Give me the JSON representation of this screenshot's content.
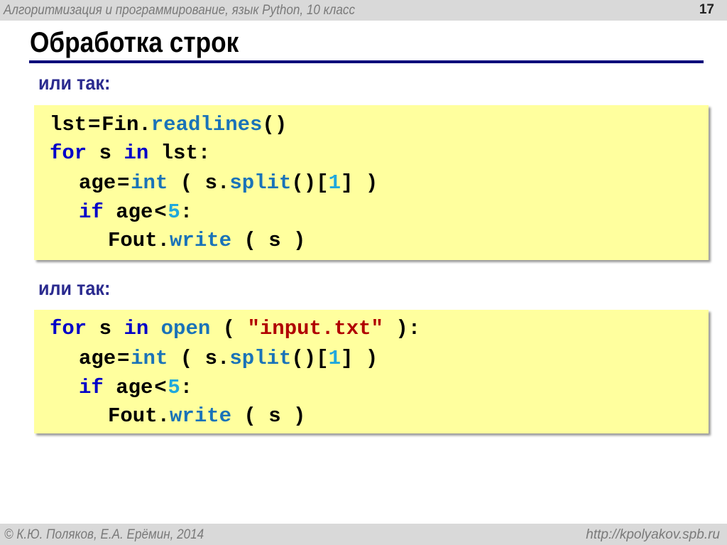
{
  "header": {
    "course": "Алгоритмизация и программирование, язык Python, 10 класс",
    "page_number": "17"
  },
  "title": "Обработка строк",
  "sections": [
    {
      "label": "или так:",
      "code": [
        {
          "indent": 0,
          "tokens": [
            [
              "t",
              "lst"
            ],
            [
              "o",
              "="
            ],
            [
              "t",
              "Fin."
            ],
            [
              "f",
              "readlines"
            ],
            [
              "t",
              "()"
            ]
          ]
        },
        {
          "indent": 0,
          "tokens": [
            [
              "k",
              "for"
            ],
            [
              "t",
              " s "
            ],
            [
              "k",
              "in"
            ],
            [
              "t",
              " lst:"
            ]
          ]
        },
        {
          "indent": 1,
          "tokens": [
            [
              "t",
              "age"
            ],
            [
              "o",
              "="
            ],
            [
              "f",
              "int"
            ],
            [
              "t",
              " ( s."
            ],
            [
              "f",
              "split"
            ],
            [
              "t",
              "()["
            ],
            [
              "n",
              "1"
            ],
            [
              "t",
              "] )"
            ]
          ]
        },
        {
          "indent": 1,
          "tokens": [
            [
              "k",
              "if"
            ],
            [
              "t",
              " age"
            ],
            [
              "o",
              "<"
            ],
            [
              "n",
              "5"
            ],
            [
              "t",
              ":"
            ]
          ]
        },
        {
          "indent": 2,
          "tokens": [
            [
              "t",
              "Fout."
            ],
            [
              "f",
              "write"
            ],
            [
              "t",
              " ( s )"
            ]
          ]
        }
      ]
    },
    {
      "label": "или так:",
      "code": [
        {
          "indent": 0,
          "tokens": [
            [
              "k",
              "for"
            ],
            [
              "t",
              " s "
            ],
            [
              "k",
              "in"
            ],
            [
              "t",
              " "
            ],
            [
              "f",
              "open"
            ],
            [
              "t",
              " ( "
            ],
            [
              "s",
              "\"input.txt\""
            ],
            [
              "t",
              " ):"
            ]
          ]
        },
        {
          "indent": 1,
          "tokens": [
            [
              "t",
              "age"
            ],
            [
              "o",
              "="
            ],
            [
              "f",
              "int"
            ],
            [
              "t",
              " ( s."
            ],
            [
              "f",
              "split"
            ],
            [
              "t",
              "()["
            ],
            [
              "n",
              "1"
            ],
            [
              "t",
              "] )"
            ]
          ]
        },
        {
          "indent": 1,
          "tokens": [
            [
              "k",
              "if"
            ],
            [
              "t",
              " age"
            ],
            [
              "o",
              "<"
            ],
            [
              "n",
              "5"
            ],
            [
              "t",
              ":"
            ]
          ]
        },
        {
          "indent": 2,
          "tokens": [
            [
              "t",
              "Fout."
            ],
            [
              "f",
              "write"
            ],
            [
              "t",
              " ( s )"
            ]
          ]
        }
      ]
    }
  ],
  "footer": {
    "copyright": "© К.Ю. Поляков, Е.А. Ерёмин, 2014",
    "url": "http://kpolyakov.spb.ru"
  },
  "colors": {
    "keyword": "#0000c8",
    "function": "#1a73b8",
    "number": "#20a8dc",
    "string": "#b00000",
    "code_bg": "#ffff9e",
    "rule": "#00007a"
  }
}
